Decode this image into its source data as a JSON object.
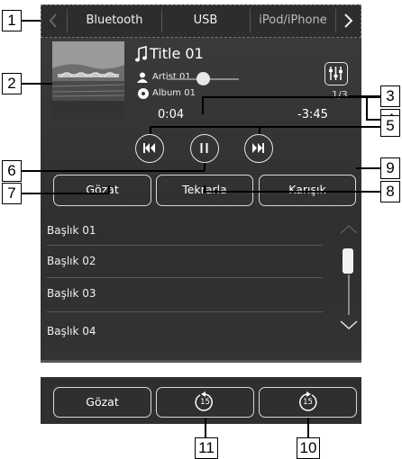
{
  "callouts": [
    "1",
    "2",
    "3",
    "4",
    "5",
    "6",
    "7",
    "8",
    "9",
    "10",
    "11"
  ],
  "source_bar": {
    "tabs": [
      "Bluetooth",
      "USB",
      "iPod/iPhone"
    ],
    "prev_icon": "chevron-left-icon",
    "next_icon": "chevron-right-icon"
  },
  "track": {
    "title": "Title 01",
    "artist": "Artist 01",
    "album": "Album 01",
    "count": "1/3",
    "elapsed": "0:04",
    "remaining": "-3:45",
    "progress": 0.03
  },
  "controls": {
    "prev_icon": "skip-previous-icon",
    "pause_icon": "pause-icon",
    "next_icon": "skip-next-icon",
    "sound_settings_icon": "equalizer-icon"
  },
  "buttons": {
    "browse": "Gözat",
    "repeat": "Tekrarla",
    "shuffle": "Karışık"
  },
  "list": {
    "items": [
      "Başlık 01",
      "Başlık 02",
      "Başlık 03",
      "Başlık 04"
    ]
  },
  "bottom_bar": {
    "browse": "Gözat",
    "rewind_seconds": "15",
    "forward_seconds": "15"
  }
}
